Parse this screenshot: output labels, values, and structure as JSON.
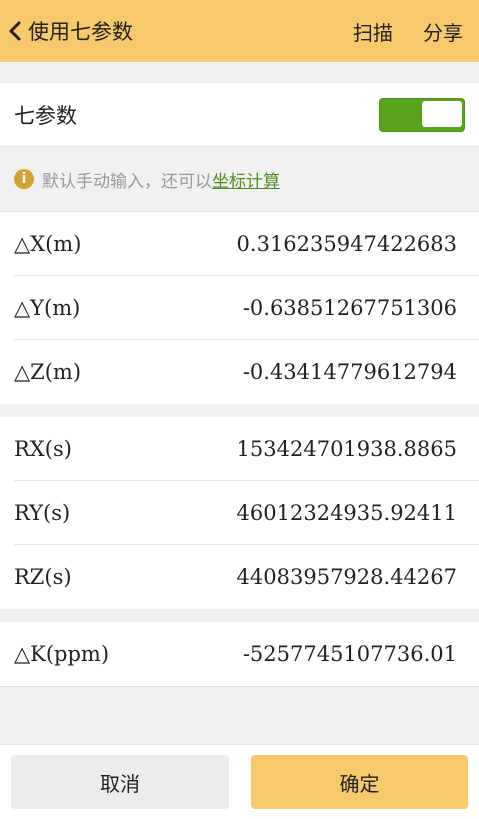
{
  "header": {
    "title": "使用七参数",
    "scan_label": "扫描",
    "share_label": "分享"
  },
  "toggle_row": {
    "label": "七参数",
    "enabled": true,
    "on_color": "#5aa31c"
  },
  "hint": {
    "text": "默认手动输入，还可以",
    "link": "坐标计算"
  },
  "translation": [
    {
      "label": "△X(m)",
      "value": "0.316235947422683"
    },
    {
      "label": "△Y(m)",
      "value": "-0.63851267751306"
    },
    {
      "label": "△Z(m)",
      "value": "-0.43414779612794"
    }
  ],
  "rotation": [
    {
      "label": "RX(s)",
      "value": "153424701938.8865"
    },
    {
      "label": "RY(s)",
      "value": "46012324935.92411"
    },
    {
      "label": "RZ(s)",
      "value": "44083957928.44267"
    }
  ],
  "scale": {
    "label": "△K(ppm)",
    "value": "-5257745107736.01"
  },
  "buttons": {
    "cancel": "取消",
    "ok": "确定"
  },
  "colors": {
    "accent": "#f7c96b",
    "link": "#4d8f1a",
    "info": "#d2a233"
  }
}
